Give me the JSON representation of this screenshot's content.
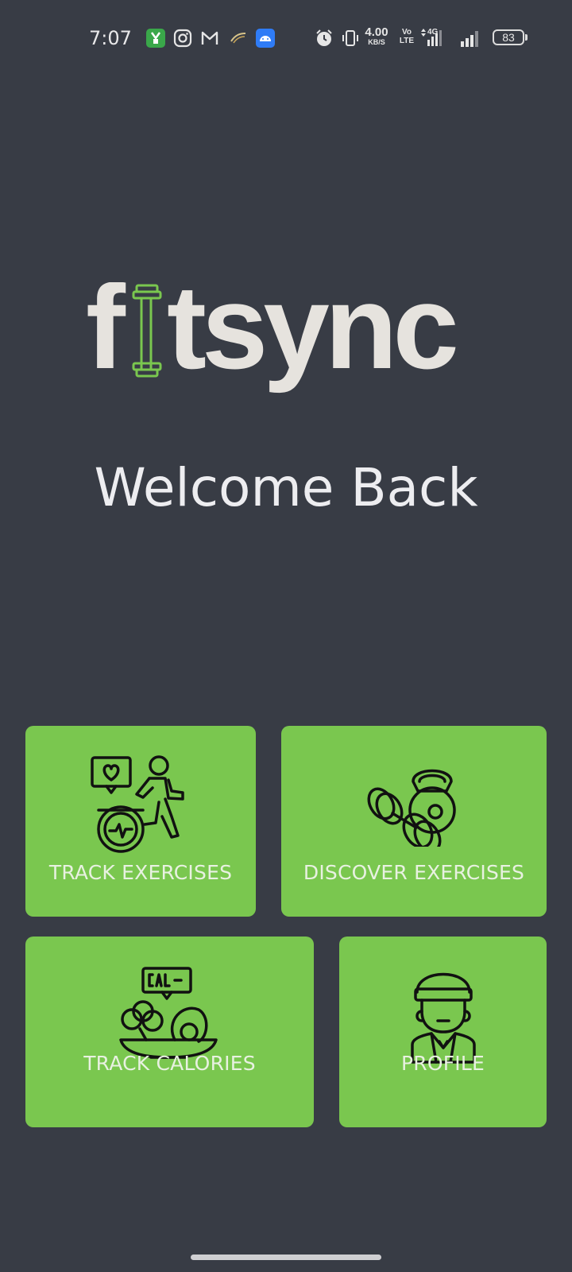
{
  "status_bar": {
    "time": "7:07",
    "net_speed_value": "4.00",
    "net_speed_unit": "KB/S",
    "volte_line1": "Vo",
    "volte_line2": "LTE",
    "network_type": "4G",
    "battery": "83",
    "icons": [
      "app-notification-icon",
      "instagram-icon",
      "gmail-icon",
      "ribbon-app-icon",
      "android-icon",
      "alarm-icon",
      "vibrate-icon",
      "data-arrows-icon",
      "signal-icon",
      "signal-icon-2",
      "battery-icon"
    ]
  },
  "logo": {
    "text_f": "f",
    "text_rest": "tsync",
    "accent_color": "#7ac74f"
  },
  "welcome": {
    "title": "Welcome Back"
  },
  "cards": [
    {
      "label": "TRACK EXERCISES",
      "icon": "runner-heart-icon"
    },
    {
      "label": "DISCOVER EXERCISES",
      "icon": "dumbbell-kettlebell-icon"
    },
    {
      "label": "TRACK CALORIES",
      "icon": "food-plate-calories-icon"
    },
    {
      "label": "PROFILE",
      "icon": "user-avatar-icon"
    }
  ],
  "colors": {
    "background": "#383c45",
    "card": "#7ac74f",
    "card_text": "#e8f1e1",
    "text": "#ededf0"
  }
}
